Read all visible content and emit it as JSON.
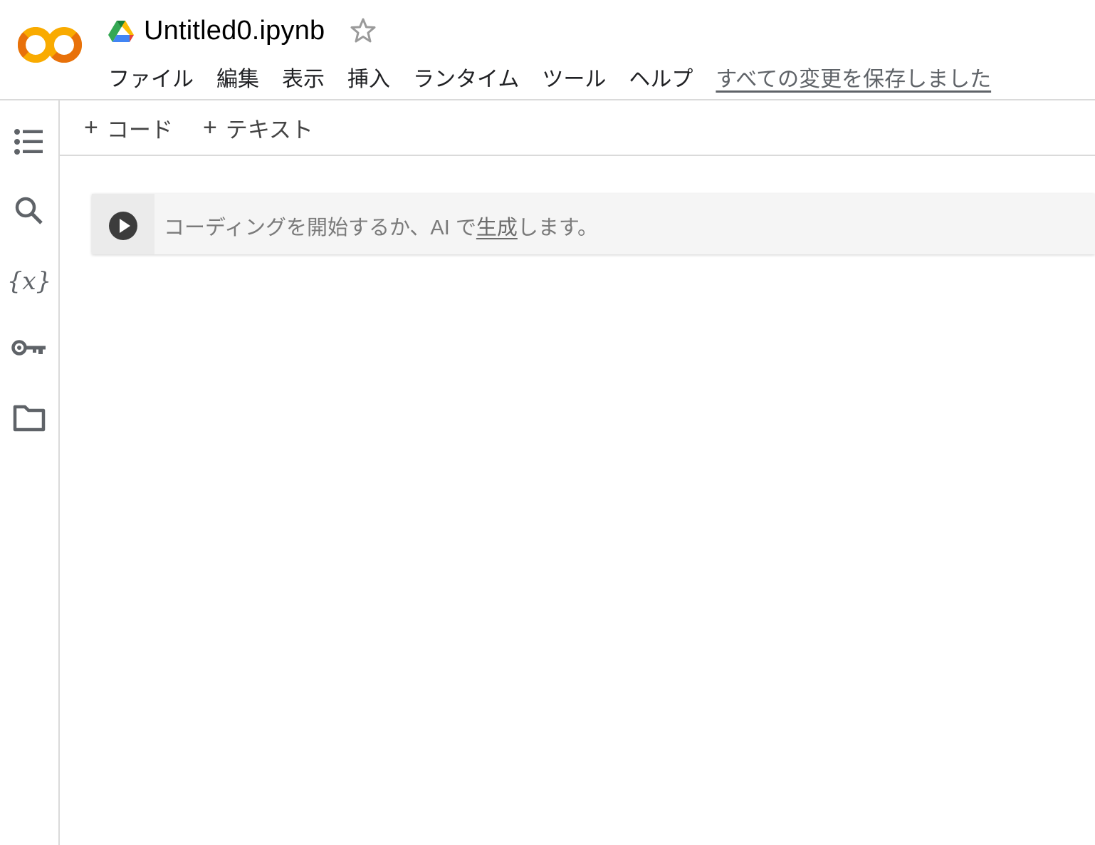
{
  "header": {
    "logo": "colab-logo",
    "title": "Untitled0.ipynb",
    "drive_icon": "google-drive-icon",
    "star_icon": "star-outline-icon",
    "menu": [
      {
        "label": "ファイル"
      },
      {
        "label": "編集"
      },
      {
        "label": "表示"
      },
      {
        "label": "挿入"
      },
      {
        "label": "ランタイム"
      },
      {
        "label": "ツール"
      },
      {
        "label": "ヘルプ"
      }
    ],
    "save_status": "すべての変更を保存しました"
  },
  "sidebar": {
    "items": [
      {
        "name": "table-of-contents",
        "icon": "list-icon"
      },
      {
        "name": "search",
        "icon": "search-icon"
      },
      {
        "name": "variables",
        "icon": "variables-icon",
        "glyph": "{x}"
      },
      {
        "name": "secrets",
        "icon": "key-icon"
      },
      {
        "name": "files",
        "icon": "folder-icon"
      }
    ]
  },
  "toolbar": {
    "add_code_label": "コード",
    "add_text_label": "テキスト",
    "plus": "+"
  },
  "cell": {
    "placeholder_before": "コーディングを開始するか、AI で",
    "placeholder_link": "生成",
    "placeholder_after": "します。",
    "run_icon": "play-circle-icon"
  },
  "colors": {
    "logo_orange_light": "#F9AB00",
    "logo_orange_dark": "#E8710A",
    "icon_gray": "#5f6368",
    "cell_bg": "#f5f5f5",
    "gutter_bg": "#ebebeb",
    "border": "#dadada"
  }
}
